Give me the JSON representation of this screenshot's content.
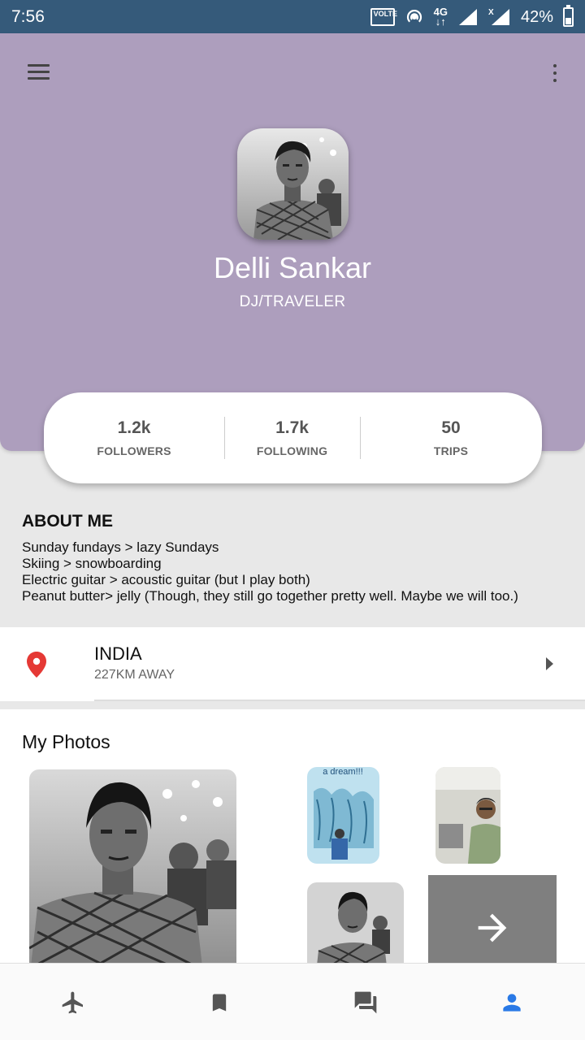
{
  "status_bar": {
    "time": "7:56",
    "volte": "VOLTE",
    "network": "4G",
    "battery": "42%"
  },
  "header": {
    "menu_icon": "hamburger-icon",
    "overflow_icon": "more-vert-icon",
    "background_color": "#ad9ebd"
  },
  "profile": {
    "name": "Delli Sankar",
    "role": "DJ/TRAVELER"
  },
  "stats": [
    {
      "value": "1.2k",
      "label": "FOLLOWERS"
    },
    {
      "value": "1.7k",
      "label": "FOLLOWING"
    },
    {
      "value": "50",
      "label": "TRIPS"
    }
  ],
  "about": {
    "title": "ABOUT ME",
    "lines": [
      "Sunday fundays > lazy Sundays",
      "Skiing > snowboarding",
      "Electric guitar > acoustic guitar (but I play both)",
      "Peanut butter> jelly (Though, they still go together pretty well. Maybe we will too.)"
    ]
  },
  "location": {
    "country": "INDIA",
    "distance": "227KM AWAY",
    "pin_color": "#e53935"
  },
  "photos": {
    "title": "My Photos",
    "dream_caption": "a dream!!!",
    "more_icon": "arrow-forward-icon"
  },
  "bottom_nav": {
    "items": [
      "flight-icon",
      "bookmark-icon",
      "forum-icon",
      "person-icon"
    ],
    "active_color": "#2979e6",
    "inactive_color": "#555555"
  }
}
